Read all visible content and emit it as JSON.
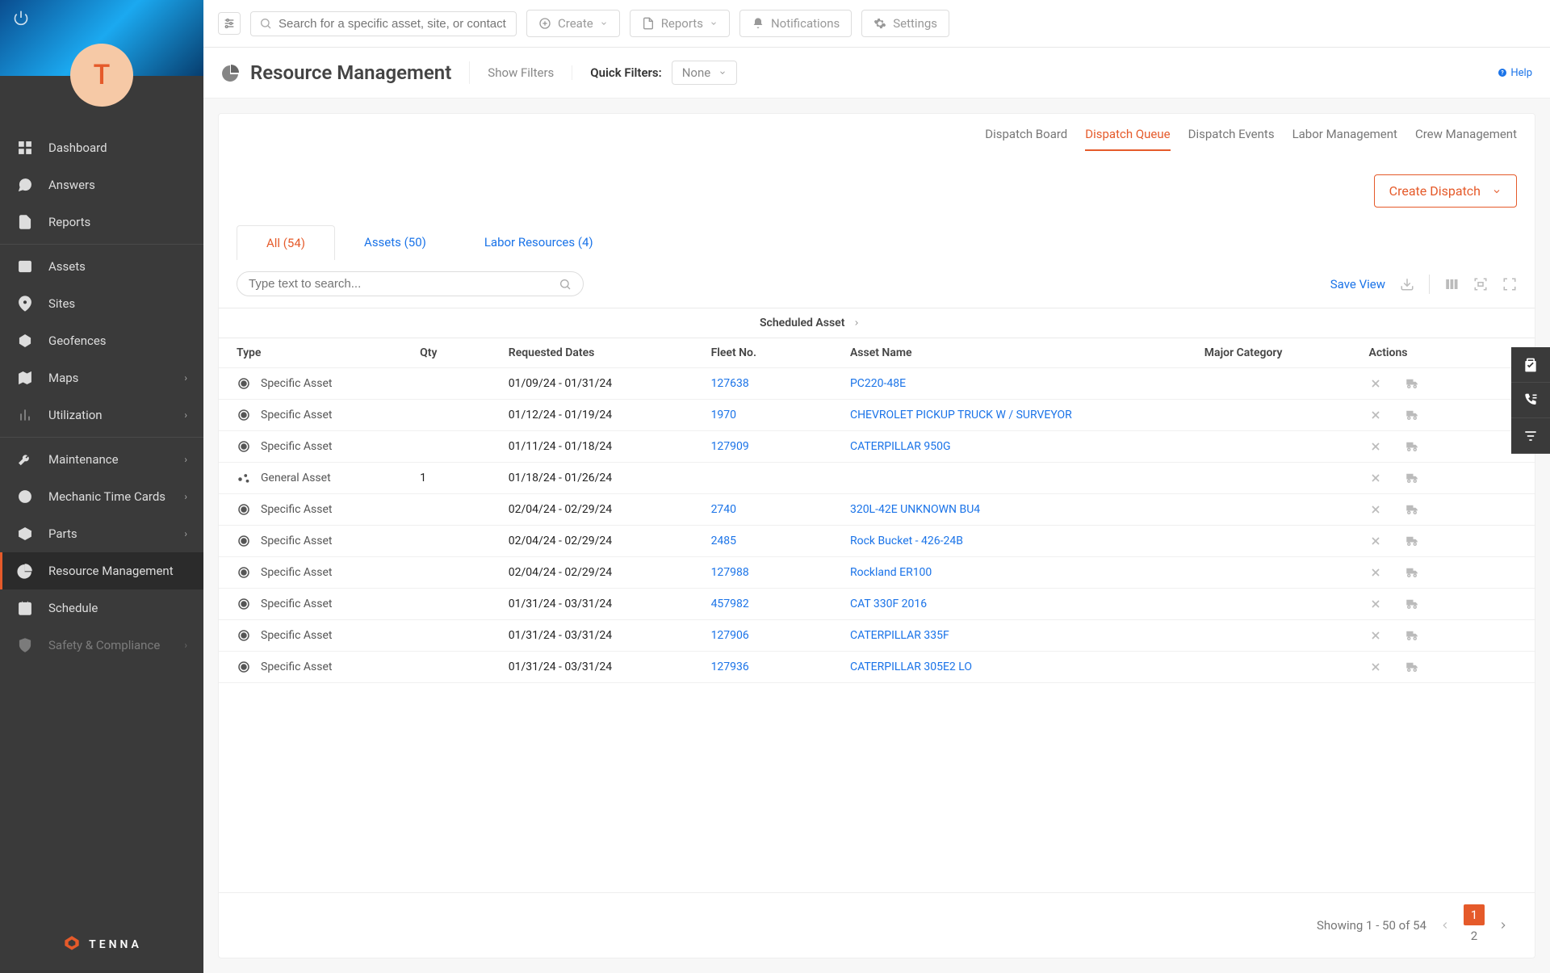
{
  "avatar_initial": "T",
  "brand_name": "TENNA",
  "search_placeholder": "Search for a specific asset, site, or contact",
  "topbar_buttons": {
    "create": "Create",
    "reports": "Reports",
    "notifications": "Notifications",
    "settings": "Settings"
  },
  "page_title": "Resource Management",
  "show_filters": "Show Filters",
  "quick_filters_label": "Quick Filters:",
  "quick_filters_value": "None",
  "help_label": "Help",
  "sidebar": [
    {
      "group": 0,
      "items": [
        {
          "label": "Dashboard",
          "icon": "dashboard"
        },
        {
          "label": "Answers",
          "icon": "chat"
        },
        {
          "label": "Reports",
          "icon": "doc"
        }
      ]
    },
    {
      "group": 1,
      "items": [
        {
          "label": "Assets",
          "icon": "list"
        },
        {
          "label": "Sites",
          "icon": "pin"
        },
        {
          "label": "Geofences",
          "icon": "geofence"
        },
        {
          "label": "Maps",
          "icon": "map",
          "expandable": true
        },
        {
          "label": "Utilization",
          "icon": "bar",
          "expandable": true
        }
      ]
    },
    {
      "group": 2,
      "items": [
        {
          "label": "Maintenance",
          "icon": "wrench",
          "expandable": true
        },
        {
          "label": "Mechanic Time Cards",
          "icon": "clock",
          "expandable": true
        },
        {
          "label": "Parts",
          "icon": "box",
          "expandable": true
        },
        {
          "label": "Resource Management",
          "icon": "pie",
          "active": true
        },
        {
          "label": "Schedule",
          "icon": "calendar"
        },
        {
          "label": "Safety & Compliance",
          "icon": "shield",
          "expandable": true,
          "faded": true
        }
      ]
    }
  ],
  "dispatch_tabs": [
    "Dispatch Board",
    "Dispatch Queue",
    "Dispatch Events",
    "Labor Management",
    "Crew Management"
  ],
  "dispatch_tab_active": 1,
  "create_dispatch": "Create Dispatch",
  "sub_tabs": [
    "All (54)",
    "Assets (50)",
    "Labor Resources (4)"
  ],
  "sub_tab_active": 0,
  "table_search_placeholder": "Type text to search...",
  "save_view": "Save View",
  "group_header": "Scheduled Asset",
  "columns": {
    "type": "Type",
    "qty": "Qty",
    "dates": "Requested Dates",
    "fleet": "Fleet No.",
    "name": "Asset Name",
    "cat": "Major Category",
    "actions": "Actions"
  },
  "rows": [
    {
      "type": "Specific Asset",
      "type_icon": "radio",
      "qty": "",
      "dates": "01/09/24 - 01/31/24",
      "fleet": "127638",
      "name": "PC220-48E",
      "cat": ""
    },
    {
      "type": "Specific Asset",
      "type_icon": "radio",
      "qty": "",
      "dates": "01/12/24 - 01/19/24",
      "fleet": "1970",
      "name": "CHEVROLET PICKUP TRUCK W / SURVEYOR",
      "cat": ""
    },
    {
      "type": "Specific Asset",
      "type_icon": "radio",
      "qty": "",
      "dates": "01/11/24 - 01/18/24",
      "fleet": "127909",
      "name": "CATERPILLAR 950G",
      "cat": ""
    },
    {
      "type": "General Asset",
      "type_icon": "general",
      "qty": "1",
      "dates": "01/18/24 - 01/26/24",
      "fleet": "",
      "name": "",
      "cat": ""
    },
    {
      "type": "Specific Asset",
      "type_icon": "radio",
      "qty": "",
      "dates": "02/04/24 - 02/29/24",
      "fleet": "2740",
      "name": "320L-42E UNKNOWN BU4",
      "cat": ""
    },
    {
      "type": "Specific Asset",
      "type_icon": "radio",
      "qty": "",
      "dates": "02/04/24 - 02/29/24",
      "fleet": "2485",
      "name": "Rock Bucket - 426-24B",
      "cat": ""
    },
    {
      "type": "Specific Asset",
      "type_icon": "radio",
      "qty": "",
      "dates": "02/04/24 - 02/29/24",
      "fleet": "127988",
      "name": "Rockland ER100",
      "cat": ""
    },
    {
      "type": "Specific Asset",
      "type_icon": "radio",
      "qty": "",
      "dates": "01/31/24 - 03/31/24",
      "fleet": "457982",
      "name": "CAT 330F 2016",
      "cat": ""
    },
    {
      "type": "Specific Asset",
      "type_icon": "radio",
      "qty": "",
      "dates": "01/31/24 - 03/31/24",
      "fleet": "127906",
      "name": "CATERPILLAR 335F",
      "cat": ""
    },
    {
      "type": "Specific Asset",
      "type_icon": "radio",
      "qty": "",
      "dates": "01/31/24 - 03/31/24",
      "fleet": "127936",
      "name": "CATERPILLAR 305E2 LO",
      "cat": ""
    }
  ],
  "pager": {
    "showing": "Showing 1 - 50 of 54",
    "pages": [
      "1",
      "2"
    ],
    "active": 0
  }
}
